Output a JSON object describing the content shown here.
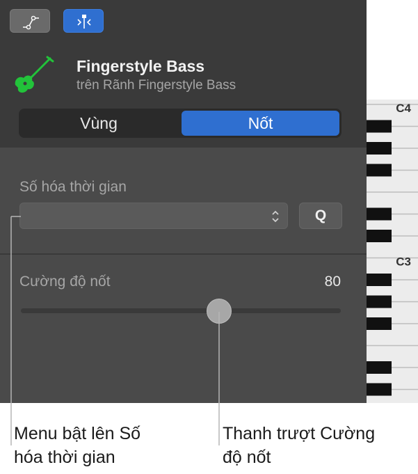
{
  "toolbar": {
    "automation_icon": "automation-curve-icon",
    "catch_icon": "catch-playhead-icon",
    "accent_color": "#2f6fd0"
  },
  "track": {
    "icon": "bass-guitar-icon",
    "icon_color": "#22c33a",
    "name": "Fingerstyle Bass",
    "subtitle": "trên Rãnh Fingerstyle Bass"
  },
  "tabs": [
    {
      "label": "Vùng",
      "selected": false
    },
    {
      "label": "Nốt",
      "selected": true
    }
  ],
  "quantize": {
    "label": "Số hóa thời gian",
    "value": "",
    "button_label": "Q"
  },
  "velocity": {
    "label": "Cường độ nốt",
    "value": "80",
    "slider_fraction": 0.62
  },
  "piano": {
    "labels": [
      "C4",
      "C3"
    ]
  },
  "callouts": {
    "menu": "Menu bật lên Số hóa thời gian",
    "slider": "Thanh trượt Cường độ nốt"
  }
}
